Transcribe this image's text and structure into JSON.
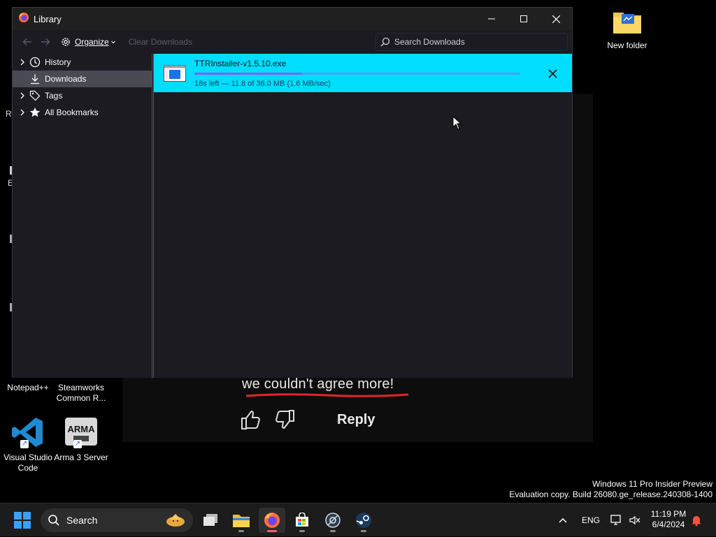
{
  "window": {
    "title": "Library",
    "controls": [
      "minimize-icon",
      "maximize-icon",
      "close-icon"
    ]
  },
  "toolbar": {
    "organize_label": "Organize",
    "clear_downloads_label": "Clear Downloads",
    "search_placeholder": "Search Downloads"
  },
  "sidebar": {
    "items": [
      {
        "label": "History",
        "icon": "clock-icon",
        "expandable": true
      },
      {
        "label": "Downloads",
        "icon": "download-icon",
        "expandable": false,
        "selected": true
      },
      {
        "label": "Tags",
        "icon": "tag-icon",
        "expandable": true
      },
      {
        "label": "All Bookmarks",
        "icon": "star-icon",
        "expandable": true
      }
    ]
  },
  "download": {
    "filename": "TTRInstaller-v1.5.10.exe",
    "status": "18s left — 11.8 of 36.0 MB (1.6 MB/sec)",
    "progress": 0.33,
    "row_color": "#00ddff"
  },
  "desktop": {
    "icons": [
      {
        "label": "New folder"
      },
      {
        "label": "Notepad++"
      },
      {
        "label": "Steamworks Common R..."
      },
      {
        "label": "Visual Studio Code"
      },
      {
        "label": "Arma 3 Server"
      }
    ],
    "video_caption": "we couldn't agree more!",
    "reply_label": "Reply",
    "watermark_line1": "Windows 11 Pro Insider Preview",
    "watermark_line2": "Evaluation copy. Build 26080.ge_release.240308-1400"
  },
  "taskbar": {
    "search_label": "Search",
    "language": "ENG",
    "time": "11:19 PM",
    "date": "6/4/2024",
    "apps": [
      "task-view-icon",
      "file-explorer-icon",
      "firefox-icon",
      "store-icon",
      "settings-app-icon",
      "steam-icon"
    ]
  }
}
